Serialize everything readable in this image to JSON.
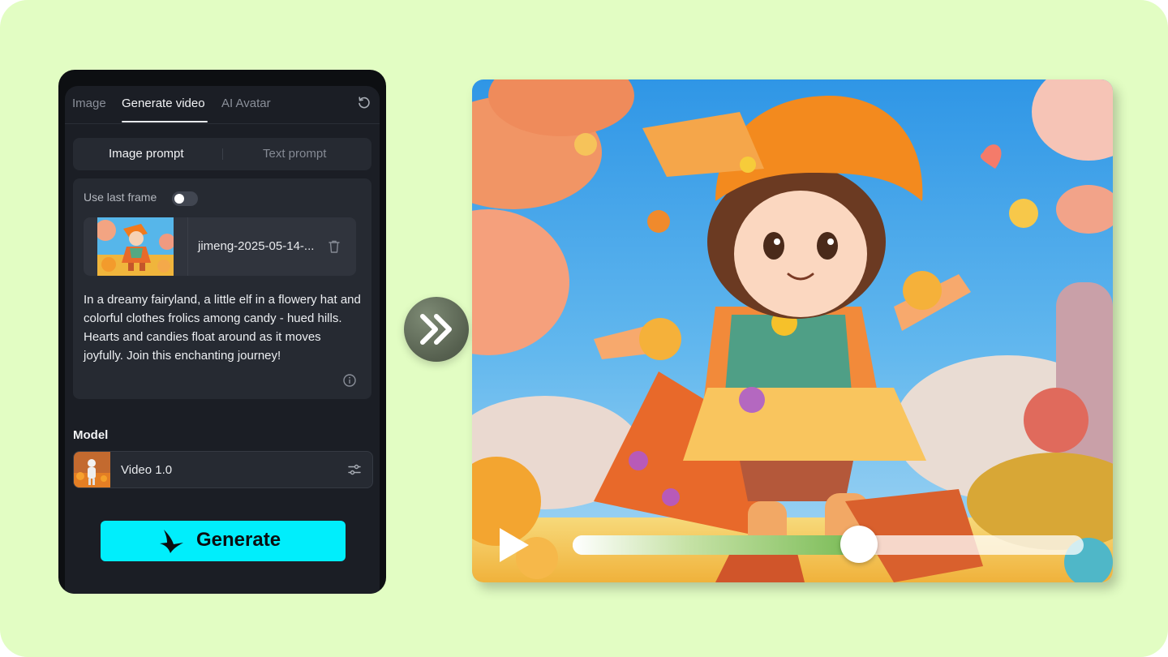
{
  "tabs": [
    {
      "label": "Image",
      "active": false
    },
    {
      "label": "Generate video",
      "active": true
    },
    {
      "label": "AI Avatar",
      "active": false
    }
  ],
  "prompt_mode": {
    "options": [
      "Image prompt",
      "Text prompt"
    ],
    "selected": "Image prompt"
  },
  "use_last_frame": {
    "label": "Use last frame",
    "enabled": false
  },
  "uploaded_image": {
    "filename": "jimeng-2025-05-14-..."
  },
  "prompt_text": "In a dreamy fairyland, a little elf in a flowery hat and colorful clothes frolics among candy - hued hills. Hearts and candies float around as it moves joyfully. Join this enchanting journey!",
  "model": {
    "heading": "Model",
    "name": "Video 1.0"
  },
  "generate": {
    "label": "Generate"
  },
  "player": {
    "progress": 0.56
  },
  "colors": {
    "background": "#e2fdc3",
    "panel": "#0d0f12",
    "accent": "#00eefc",
    "progress": "#79bb55"
  },
  "icons": {
    "refresh": "refresh-icon",
    "trash": "trash-icon",
    "info": "info-icon",
    "settings": "sliders-icon",
    "forward": "double-chevron-right-icon",
    "play": "play-icon",
    "brand": "generate-logo-icon"
  }
}
